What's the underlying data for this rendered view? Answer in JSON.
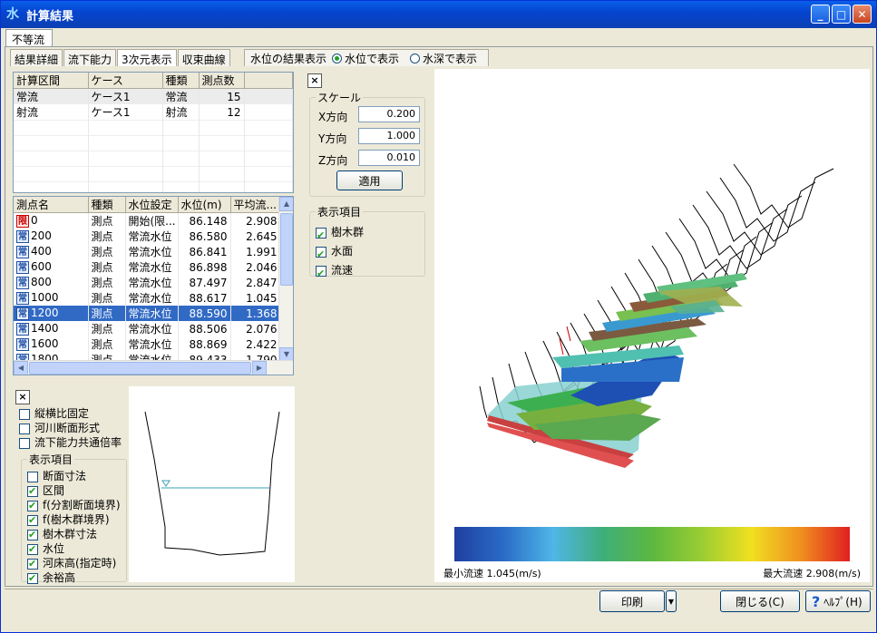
{
  "window": {
    "title": "計算結果",
    "app_icon": "水"
  },
  "outer_tab": "不等流",
  "subtabs": [
    "結果詳細",
    "流下能力",
    "3次元表示",
    "収束曲線"
  ],
  "water_level_display": {
    "label": "水位の結果表示",
    "options": [
      "水位で表示",
      "水深で表示"
    ],
    "selected": "水位で表示"
  },
  "section_table": {
    "headers": [
      "計算区間",
      "ケース",
      "種類",
      "測点数"
    ],
    "rows": [
      [
        "常流",
        "ケース1",
        "常流",
        "15"
      ],
      [
        "射流",
        "ケース1",
        "射流",
        "12"
      ]
    ]
  },
  "station_table": {
    "headers": [
      "測点名",
      "種類",
      "水位設定",
      "水位(m)",
      "平均流..."
    ],
    "rows": [
      {
        "icon": "限",
        "name": "0",
        "type": "測点",
        "setting": "開始(限...",
        "wl": "86.148",
        "avg": "2.908"
      },
      {
        "icon": "常",
        "name": "200",
        "type": "測点",
        "setting": "常流水位",
        "wl": "86.580",
        "avg": "2.645"
      },
      {
        "icon": "常",
        "name": "400",
        "type": "測点",
        "setting": "常流水位",
        "wl": "86.841",
        "avg": "1.991"
      },
      {
        "icon": "常",
        "name": "600",
        "type": "測点",
        "setting": "常流水位",
        "wl": "86.898",
        "avg": "2.046"
      },
      {
        "icon": "常",
        "name": "800",
        "type": "測点",
        "setting": "常流水位",
        "wl": "87.497",
        "avg": "2.847"
      },
      {
        "icon": "常",
        "name": "1000",
        "type": "測点",
        "setting": "常流水位",
        "wl": "88.617",
        "avg": "1.045"
      },
      {
        "icon": "常",
        "name": "1200",
        "type": "測点",
        "setting": "常流水位",
        "wl": "88.590",
        "avg": "1.368"
      },
      {
        "icon": "常",
        "name": "1400",
        "type": "測点",
        "setting": "常流水位",
        "wl": "88.506",
        "avg": "2.076"
      },
      {
        "icon": "常",
        "name": "1600",
        "type": "測点",
        "setting": "常流水位",
        "wl": "88.869",
        "avg": "2.422"
      },
      {
        "icon": "常",
        "name": "1800",
        "type": "測点",
        "setting": "常流水位",
        "wl": "89.433",
        "avg": "1.790"
      }
    ]
  },
  "close_x": "×",
  "section_options": {
    "checks": [
      {
        "label": "縦横比固定",
        "on": false
      },
      {
        "label": "河川断面形式",
        "on": false
      },
      {
        "label": "流下能力共通倍率",
        "on": false
      }
    ],
    "group_label": "表示項目",
    "items": [
      {
        "label": "断面寸法",
        "on": false
      },
      {
        "label": "区間",
        "on": true
      },
      {
        "label": "f(分割断面境界)",
        "on": true
      },
      {
        "label": "f(樹木群境界)",
        "on": true
      },
      {
        "label": "樹木群寸法",
        "on": true
      },
      {
        "label": "水位",
        "on": true
      },
      {
        "label": "河床高(指定時)",
        "on": true
      },
      {
        "label": "余裕高",
        "on": true
      }
    ]
  },
  "scale": {
    "label": "スケール",
    "x_label": "X方向",
    "x_value": "0.200",
    "y_label": "Y方向",
    "y_value": "1.000",
    "z_label": "Z方向",
    "z_value": "0.010",
    "apply": "適用"
  },
  "view_items": {
    "label": "表示項目",
    "items": [
      {
        "label": "樹木群",
        "on": true
      },
      {
        "label": "水面",
        "on": true
      },
      {
        "label": "流速",
        "on": true
      }
    ]
  },
  "colorbar": {
    "min_label": "最小流速 1.045(m/s)",
    "max_label": "最大流速 2.908(m/s)",
    "colors": [
      "#1f3f9f",
      "#2a6cc8",
      "#4fb6e6",
      "#3fae7a",
      "#5cb840",
      "#9acd32",
      "#f0e020",
      "#f09020",
      "#e02020"
    ]
  },
  "footer": {
    "print": "印刷",
    "close": "閉じる(C)",
    "help": "ﾍﾙﾌﾟ(H)"
  }
}
